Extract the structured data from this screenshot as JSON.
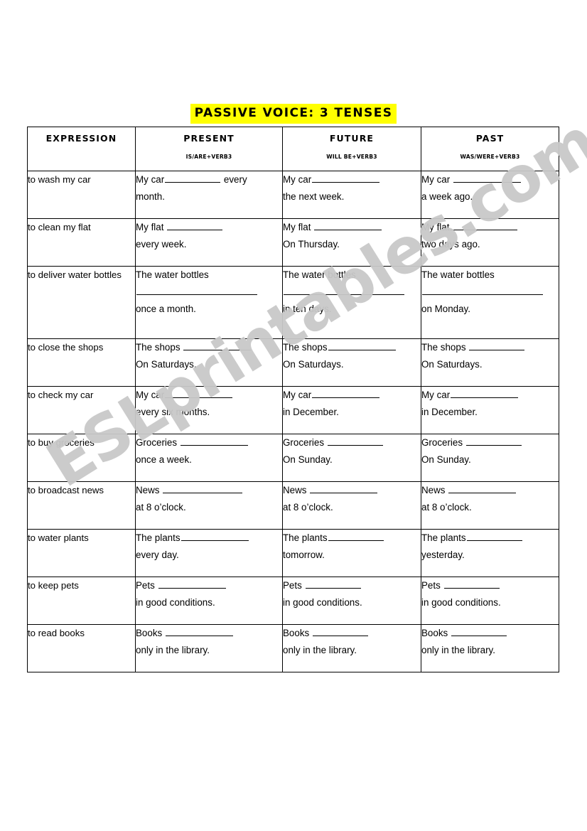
{
  "title": "PASSIVE VOICE: 3 TENSES",
  "watermark": "ESLprintables.com",
  "colors": {
    "title_highlight": "#ffff00",
    "text": "#000000",
    "border": "#000000",
    "watermark": "#c9c9c9",
    "page_background": "#ffffff"
  },
  "table": {
    "headers": [
      {
        "main": "EXPRESSION",
        "sub": ""
      },
      {
        "main": "PRESENT",
        "sub": "IS/ARE+VERB3"
      },
      {
        "main": "FUTURE",
        "sub": "WILL BE+VERB3"
      },
      {
        "main": "PAST",
        "sub": "WAS/WERE+VERB3"
      }
    ],
    "rows": [
      {
        "expression": "to wash my car",
        "present": {
          "l1a": "My car",
          "blank1": "md",
          "l1b": " every",
          "l2": "month."
        },
        "future": {
          "l1a": "My car",
          "blank1": "lg",
          "l1b": "",
          "l2": "the next week."
        },
        "past": {
          "l1a": "My car ",
          "blank1": "lg",
          "l1b": "",
          "l2": "a week ago."
        }
      },
      {
        "expression": "to clean my flat",
        "present": {
          "l1a": "My flat ",
          "blank1": "md",
          "l1b": "",
          "l2": "every week."
        },
        "future": {
          "l1a": "My flat ",
          "blank1": "lg",
          "l1b": "",
          "l2": "On Thursday."
        },
        "past": {
          "l1a": "My flat",
          "blank1": "lg",
          "l1b": "",
          "l2": "two days ago."
        }
      },
      {
        "expression": "to deliver water bottles",
        "present": {
          "l1a": "The water bottles",
          "blank1": "none",
          "l1b": "",
          "lmid": "full",
          "l2": "once a month."
        },
        "future": {
          "l1a": "The water bottles",
          "blank1": "none",
          "l1b": "",
          "lmid": "full",
          "l2": "in ten days."
        },
        "past": {
          "l1a": "The water bottles",
          "blank1": "none",
          "l1b": "",
          "lmid": "full",
          "l2": "on Monday."
        }
      },
      {
        "expression": "to close the shops",
        "present": {
          "l1a": "The shops ",
          "blank1": "lg",
          "l1b": "",
          "l2": "On Saturdays."
        },
        "future": {
          "l1a": "The shops",
          "blank1": "lg",
          "l1b": "",
          "l2": "On Saturdays."
        },
        "past": {
          "l1a": "The shops ",
          "blank1": "md",
          "l1b": "",
          "l2": "On Saturdays."
        }
      },
      {
        "expression": "to check my car",
        "present": {
          "l1a": "My car",
          "blank1": "lg",
          "l1b": "",
          "l2": "every six months."
        },
        "future": {
          "l1a": "My car",
          "blank1": "lg",
          "l1b": "",
          "l2": "in December."
        },
        "past": {
          "l1a": "My car",
          "blank1": "lg",
          "l1b": "",
          "l2": "in December."
        }
      },
      {
        "expression": "to buy groceries",
        "present": {
          "l1a": "Groceries ",
          "blank1": "lg",
          "l1b": "",
          "l2": "once a week."
        },
        "future": {
          "l1a": "Groceries ",
          "blank1": "md",
          "l1b": "",
          "l2": "On Sunday."
        },
        "past": {
          "l1a": "Groceries ",
          "blank1": "md",
          "l1b": "",
          "l2": "On Sunday."
        }
      },
      {
        "expression": "to broadcast news",
        "present": {
          "l1a": "News ",
          "blank1": "xl",
          "l1b": "",
          "l2": "at 8 o’clock."
        },
        "future": {
          "l1a": "News ",
          "blank1": "lg",
          "l1b": "",
          "l2": "at 8 o’clock."
        },
        "past": {
          "l1a": "News ",
          "blank1": "lg",
          "l1b": "",
          "l2": "at 8 o’clock."
        }
      },
      {
        "expression": "to water plants",
        "present": {
          "l1a": "The plants",
          "blank1": "lg",
          "l1b": "",
          "l2": "every day."
        },
        "future": {
          "l1a": "The plants",
          "blank1": "md",
          "l1b": "",
          "l2": "tomorrow."
        },
        "past": {
          "l1a": "The plants",
          "blank1": "md",
          "l1b": "",
          "l2": "yesterday."
        }
      },
      {
        "expression": "to keep pets",
        "present": {
          "l1a": "Pets ",
          "blank1": "lg",
          "l1b": "",
          "l2": "in good conditions."
        },
        "future": {
          "l1a": "Pets ",
          "blank1": "md",
          "l1b": "",
          "l2": "in good conditions."
        },
        "past": {
          "l1a": "Pets ",
          "blank1": "md",
          "l1b": "",
          "l2": "in good conditions."
        }
      },
      {
        "expression": "to read books",
        "present": {
          "l1a": "Books ",
          "blank1": "lg",
          "l1b": "",
          "l2": "only in the library."
        },
        "future": {
          "l1a": "Books ",
          "blank1": "md",
          "l1b": "",
          "l2": "only in the library."
        },
        "past": {
          "l1a": "Books ",
          "blank1": "md",
          "l1b": "",
          "l2": "only in the library."
        }
      }
    ]
  }
}
